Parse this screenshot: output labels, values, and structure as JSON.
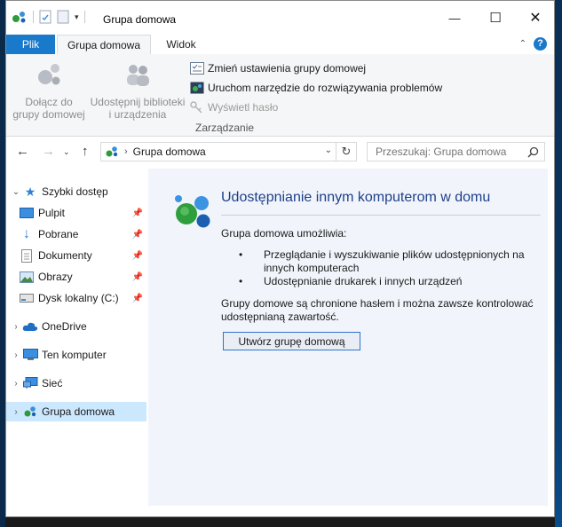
{
  "window": {
    "title": "Grupa domowa",
    "controls": {
      "minimize": "—",
      "maximize": "☐",
      "close": "✕"
    }
  },
  "ribbon_tabs": {
    "file": "Plik",
    "home": "Grupa domowa",
    "view": "Widok"
  },
  "ribbon": {
    "join_label_1": "Dołącz do",
    "join_label_2": "grupy domowej",
    "share_label_1": "Udostępnij biblioteki",
    "share_label_2": "i urządzenia",
    "change_settings": "Zmień ustawienia grupy domowej",
    "troubleshooter": "Uruchom narzędzie do rozwiązywania problemów",
    "show_password": "Wyświetl hasło",
    "group_label": "Zarządzanie"
  },
  "address": {
    "location": "Grupa domowa",
    "search_placeholder": "Przeszukaj: Grupa domowa"
  },
  "nav": {
    "quick_access": "Szybki dostęp",
    "items": [
      {
        "label": "Pulpit"
      },
      {
        "label": "Pobrane"
      },
      {
        "label": "Dokumenty"
      },
      {
        "label": "Obrazy"
      },
      {
        "label": "Dysk lokalny (C:)"
      }
    ],
    "onedrive": "OneDrive",
    "this_pc": "Ten komputer",
    "network": "Sieć",
    "homegroup": "Grupa domowa"
  },
  "content": {
    "heading": "Udostępnianie innym komputerom w domu",
    "intro": "Grupa domowa umożliwia:",
    "bullet_1_line_1": "Przeglądanie i wyszukiwanie plików udostępnionych na",
    "bullet_1_line_2": "innych komputerach",
    "bullet_2": "Udostępnianie drukarek i innych urządzeń",
    "note_line_1": "Grupy domowe są chronione hasłem i można zawsze kontrolować",
    "note_line_2": "udostępnianą zawartość.",
    "create_button": "Utwórz grupę domową"
  },
  "colors": {
    "accent": "#1979ca",
    "heading": "#1e3f8a",
    "content_bg": "#f1f5fb",
    "selection": "#cce8ff"
  }
}
